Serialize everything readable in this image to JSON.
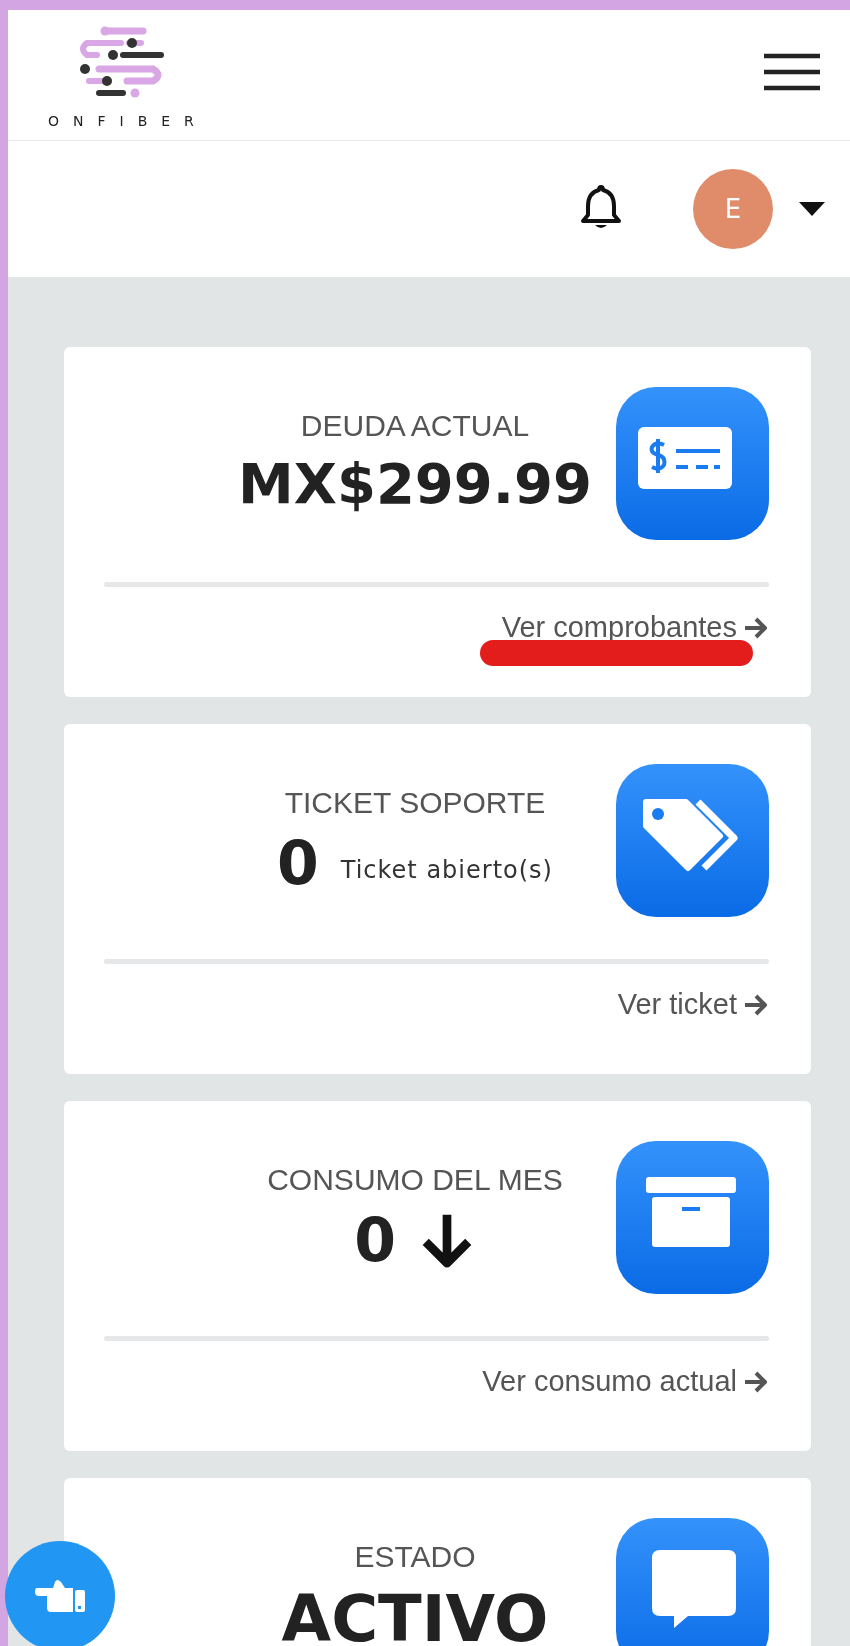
{
  "header": {
    "logo_text": "ONFIBER"
  },
  "user": {
    "avatar_initial": "E"
  },
  "cards": [
    {
      "kind": "amount",
      "title": "DEUDA ACTUAL",
      "value": "MX$299.99",
      "link": "Ver comprobantes",
      "underlined": true
    },
    {
      "kind": "count",
      "title": "TICKET SOPORTE",
      "value": "0",
      "unit": "Ticket abierto(s)",
      "link": "Ver ticket",
      "underlined": false
    },
    {
      "kind": "trend",
      "title": "CONSUMO DEL MES",
      "value": "0",
      "link": "Ver consumo actual",
      "underlined": false
    },
    {
      "kind": "status",
      "title": "ESTADO",
      "value": "ACTIVO"
    }
  ]
}
